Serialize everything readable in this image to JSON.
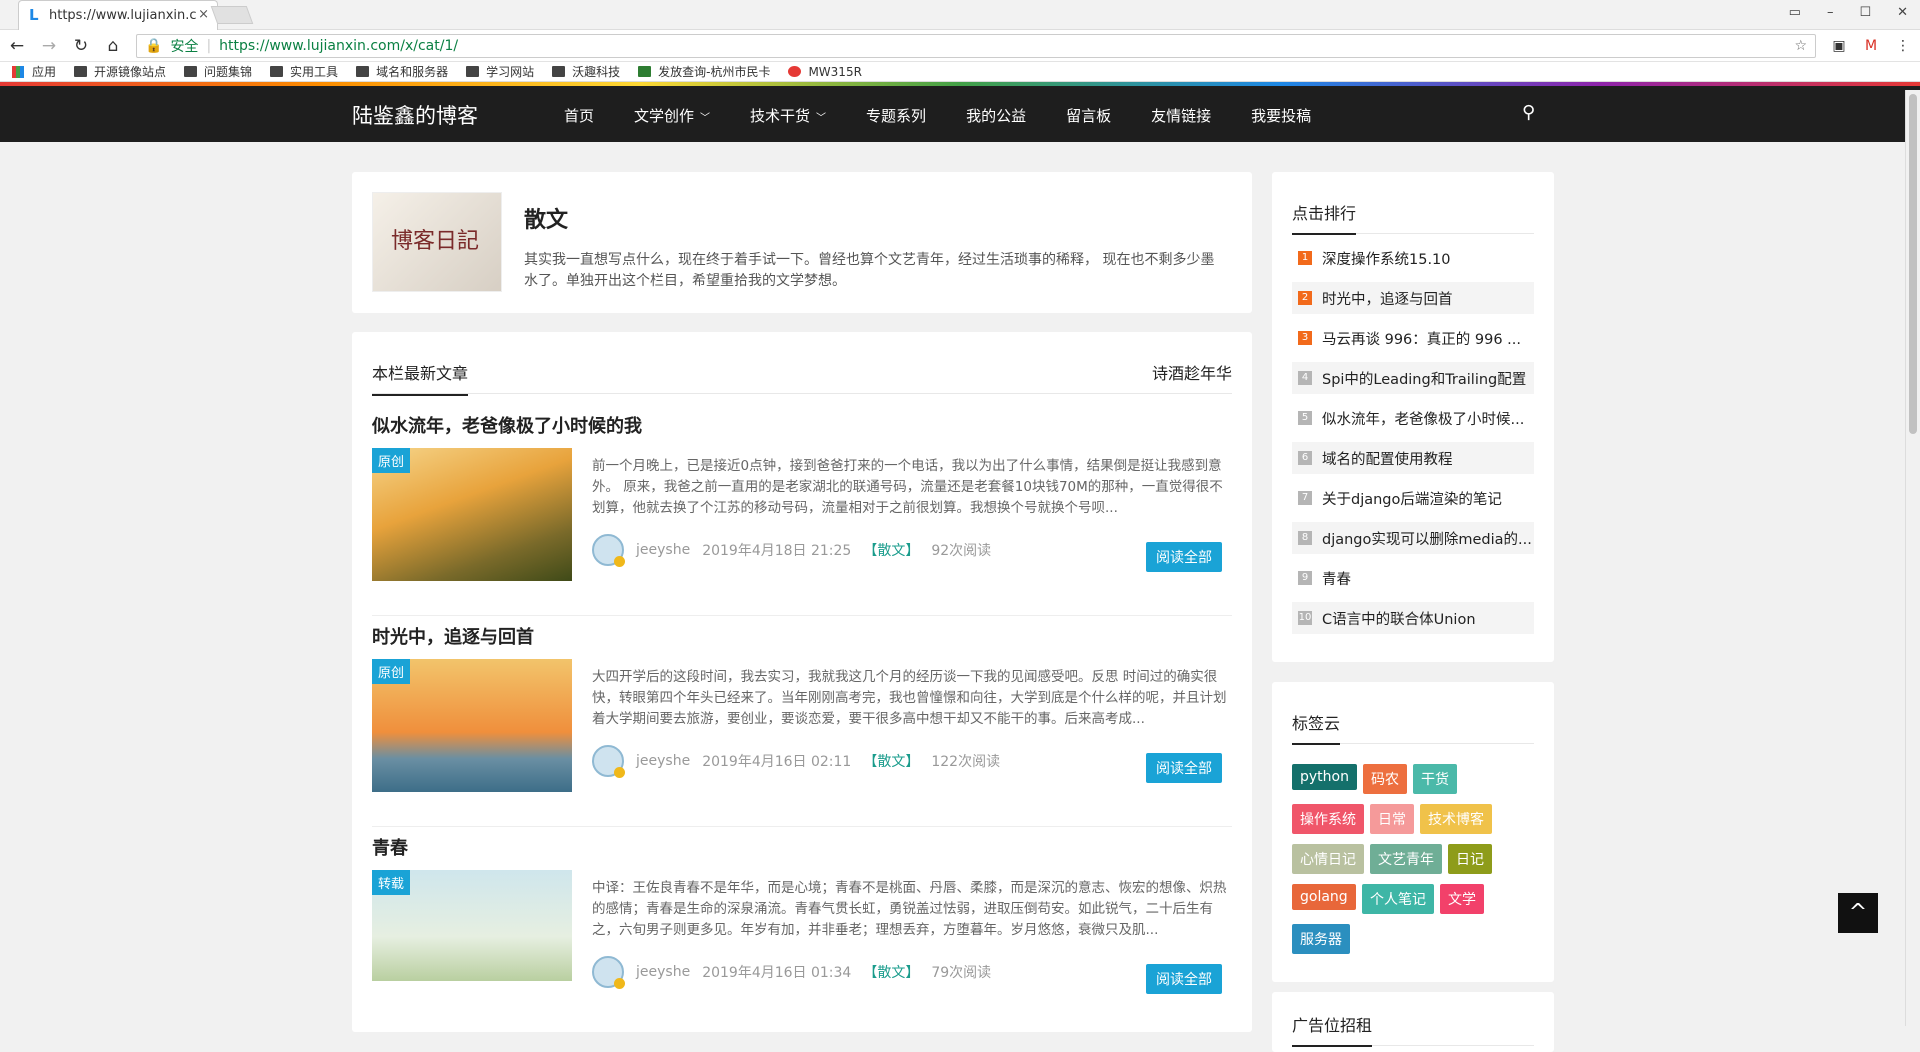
{
  "browser": {
    "tab_title": "https://www.lujianxin.c",
    "tab_close": "×",
    "security_label": "安全",
    "url": "https://www.lujianxin.com/x/cat/1/",
    "bookmarks": [
      "应用",
      "开源镜像站点",
      "问题集锦",
      "实用工具",
      "域名和服务器",
      "学习网站",
      "沃趣科技",
      "发放查询-杭州市民卡",
      "MW315R"
    ]
  },
  "site": {
    "logo": "陆鉴鑫的博客",
    "nav": [
      "首页",
      "文学创作",
      "技术干货",
      "专题系列",
      "我的公益",
      "留言板",
      "友情链接",
      "我要投稿"
    ]
  },
  "category": {
    "image_text": "博客日記",
    "title": "散文",
    "desc": "其实我一直想写点什么，现在终于着手试一下。曾经也算个文艺青年，经过生活琐事的稀释， 现在也不剩多少墨水了。单独开出这个栏目，希望重拾我的文学梦想。"
  },
  "list": {
    "heading": "本栏最新文章",
    "right_link": "诗酒趁年华",
    "posts": [
      {
        "title": "似水流年，老爸像极了小时候的我",
        "badge": "原创",
        "excerpt": "前一个月晚上，已是接近0点钟，接到爸爸打来的一个电话，我以为出了什么事情，结果倒是挺让我感到意外。 原来，我爸之前一直用的是老家湖北的联通号码，流量还是老套餐10块钱70M的那种，一直觉得很不划算，他就去换了个江苏的移动号码，流量相对于之前很划算。我想换个号就换个号呗...",
        "author": "jeeyshe",
        "date": "2019年4月18日 21:25",
        "cat": "【散文】",
        "views": "92次阅读",
        "btn": "阅读全部"
      },
      {
        "title": "时光中，追逐与回首",
        "badge": "原创",
        "excerpt": "大四开学后的这段时间，我去实习，我就我这几个月的经历谈一下我的见闻感受吧。反思 时间过的确实很快，转眼第四个年头已经来了。当年刚刚高考完，我也曾憧憬和向往，大学到底是个什么样的呢，并且计划着大学期间要去旅游，要创业，要谈恋爱，要干很多高中想干却又不能干的事。后来高考成...",
        "author": "jeeyshe",
        "date": "2019年4月16日 02:11",
        "cat": "【散文】",
        "views": "122次阅读",
        "btn": "阅读全部"
      },
      {
        "title": "青春",
        "badge": "转载",
        "excerpt": "中译：王佐良青春不是年华，而是心境；青春不是桃面、丹唇、柔膝，而是深沉的意志、恢宏的想像、炽热的感情；青春是生命的深泉涌流。青春气贯长虹，勇锐盖过怯弱，进取压倒苟安。如此锐气，二十后生有之，六旬男子则更多见。年岁有加，并非垂老；理想丢弃，方堕暮年。岁月悠悠，衰微只及肌...",
        "author": "jeeyshe",
        "date": "2019年4月16日 01:34",
        "cat": "【散文】",
        "views": "79次阅读",
        "btn": "阅读全部"
      }
    ]
  },
  "rank": {
    "heading": "点击排行",
    "items": [
      {
        "n": "1",
        "t": "深度操作系统15.10"
      },
      {
        "n": "2",
        "t": "时光中，追逐与回首"
      },
      {
        "n": "3",
        "t": "马云再谈 996：真正的 996 ..."
      },
      {
        "n": "4",
        "t": "Spi中的Leading和Trailing配置"
      },
      {
        "n": "5",
        "t": "似水流年，老爸像极了小时候..."
      },
      {
        "n": "6",
        "t": "域名的配置使用教程"
      },
      {
        "n": "7",
        "t": "关于django后端渲染的笔记"
      },
      {
        "n": "8",
        "t": "django实现可以删除media的..."
      },
      {
        "n": "9",
        "t": "青春"
      },
      {
        "n": "10",
        "t": "C语言中的联合体Union"
      }
    ],
    "colors": {
      "top": "#f26a1b",
      "rest": "#b5b5b5"
    }
  },
  "tags": {
    "heading": "标签云",
    "items": [
      {
        "t": "python",
        "c": "#14706b"
      },
      {
        "t": "码农",
        "c": "#ed6f3f"
      },
      {
        "t": "干货",
        "c": "#4bb9a9"
      },
      {
        "t": "操作系统",
        "c": "#f0566a"
      },
      {
        "t": "日常",
        "c": "#f59a9a"
      },
      {
        "t": "技术博客",
        "c": "#f0c24a"
      },
      {
        "t": "心情日记",
        "c": "#b9c1a0"
      },
      {
        "t": "文艺青年",
        "c": "#6fae96"
      },
      {
        "t": "日记",
        "c": "#8e9c1a"
      },
      {
        "t": "golang",
        "c": "#e8673a"
      },
      {
        "t": "个人笔记",
        "c": "#3eb6a6"
      },
      {
        "t": "文学",
        "c": "#f2416a"
      },
      {
        "t": "服务器",
        "c": "#2b8fbf"
      }
    ]
  },
  "ad": {
    "heading": "广告位招租"
  },
  "totop": "^"
}
